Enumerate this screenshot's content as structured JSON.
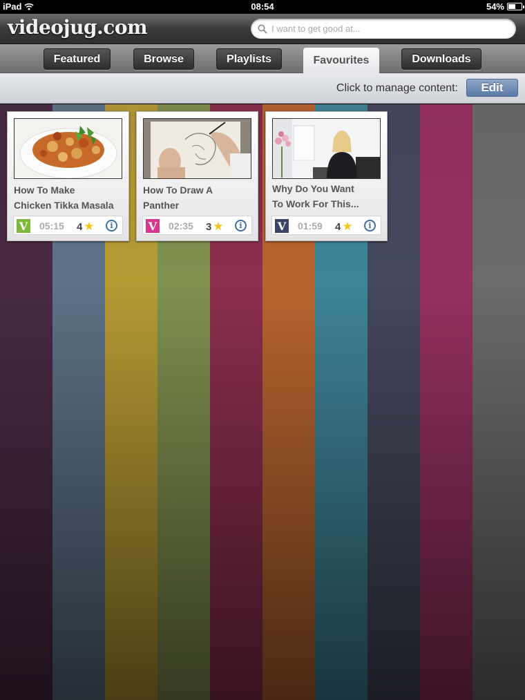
{
  "status_bar": {
    "device": "iPad",
    "time": "08:54",
    "battery": "54%",
    "battery_level": 0.54
  },
  "header": {
    "logo": "videojug.com",
    "search": {
      "placeholder": "I want to get good at...",
      "value": ""
    }
  },
  "tabs": [
    {
      "label": "Featured",
      "active": false
    },
    {
      "label": "Browse",
      "active": false
    },
    {
      "label": "Playlists",
      "active": false
    },
    {
      "label": "Favourites",
      "active": true
    },
    {
      "label": "Downloads",
      "active": false
    }
  ],
  "manage": {
    "label": "Click to manage content:",
    "edit_label": "Edit"
  },
  "favourites": [
    {
      "title_line1": "How To Make",
      "title_line2": "Chicken Tikka Masala",
      "duration": "05:15",
      "rating": "4",
      "badge_color": "#7fb83a",
      "thumb": "food-dish"
    },
    {
      "title_line1": "How To Draw A",
      "title_line2": "Panther",
      "duration": "02:35",
      "rating": "3",
      "badge_color": "#d6378c",
      "thumb": "drawing"
    },
    {
      "title_line1": "Why Do You Want",
      "title_line2": "To Work For This...",
      "duration": "01:59",
      "rating": "4",
      "badge_color": "#3a4668",
      "thumb": "interview"
    }
  ],
  "colors": {
    "stripes": [
      "#4a2a44",
      "#5d7287",
      "#b59a34",
      "#80904f",
      "#8a2f4e",
      "#b7652f",
      "#3f8497",
      "#45485c",
      "#94315f",
      "#6b6b6b"
    ],
    "edit_button": "#6f8db8"
  },
  "icons": {
    "search": "search-icon",
    "wifi": "wifi-icon",
    "battery": "battery-icon",
    "info": "info-icon",
    "star": "star-icon"
  }
}
